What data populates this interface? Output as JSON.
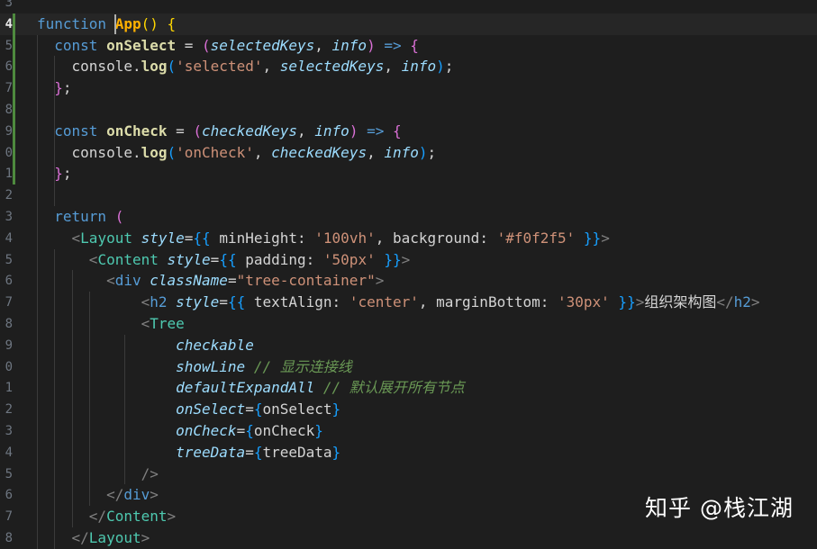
{
  "editor": {
    "gutter_numbers": [
      "3",
      "4",
      "5",
      "6",
      "7",
      "8",
      "9",
      "0",
      "1",
      "2",
      "3",
      "4",
      "5",
      "6",
      "7",
      "8",
      "9",
      "0",
      "1",
      "2",
      "3",
      "4",
      "5",
      "6",
      "7",
      "8"
    ],
    "current_line_index": 1,
    "lines": [
      {
        "tokens": []
      },
      {
        "tokens": [
          [
            "k",
            "function "
          ],
          [
            "fo",
            "App"
          ],
          [
            "p",
            "() {"
          ]
        ]
      },
      {
        "tokens": [
          [
            "k",
            "  const "
          ],
          [
            "f",
            "onSelect"
          ],
          [
            "",
            " = "
          ],
          [
            "pp",
            "("
          ],
          [
            "v",
            "selectedKeys"
          ],
          [
            "",
            ", "
          ],
          [
            "v",
            "info"
          ],
          [
            "pp",
            ")"
          ],
          [
            "k",
            " => "
          ],
          [
            "pp",
            "{"
          ]
        ]
      },
      {
        "tokens": [
          [
            "",
            "    console."
          ],
          [
            "f",
            "log"
          ],
          [
            "pb",
            "("
          ],
          [
            "s",
            "'selected'"
          ],
          [
            "",
            ", "
          ],
          [
            "v",
            "selectedKeys"
          ],
          [
            "",
            ", "
          ],
          [
            "v",
            "info"
          ],
          [
            "pb",
            ")"
          ],
          [
            "",
            ";"
          ]
        ]
      },
      {
        "tokens": [
          [
            "pp",
            "  }"
          ],
          [
            "",
            ";"
          ]
        ]
      },
      {
        "tokens": []
      },
      {
        "tokens": [
          [
            "k",
            "  const "
          ],
          [
            "f",
            "onCheck"
          ],
          [
            "",
            " = "
          ],
          [
            "pp",
            "("
          ],
          [
            "v",
            "checkedKeys"
          ],
          [
            "",
            ", "
          ],
          [
            "v",
            "info"
          ],
          [
            "pp",
            ")"
          ],
          [
            "k",
            " => "
          ],
          [
            "pp",
            "{"
          ]
        ]
      },
      {
        "tokens": [
          [
            "",
            "    console."
          ],
          [
            "f",
            "log"
          ],
          [
            "pb",
            "("
          ],
          [
            "s",
            "'onCheck'"
          ],
          [
            "",
            ", "
          ],
          [
            "v",
            "checkedKeys"
          ],
          [
            "",
            ", "
          ],
          [
            "v",
            "info"
          ],
          [
            "pb",
            ")"
          ],
          [
            "",
            ";"
          ]
        ]
      },
      {
        "tokens": [
          [
            "pp",
            "  }"
          ],
          [
            "",
            ";"
          ]
        ]
      },
      {
        "tokens": []
      },
      {
        "tokens": [
          [
            "k",
            "  return "
          ],
          [
            "pp",
            "("
          ]
        ]
      },
      {
        "tokens": [
          [
            "g",
            "    <"
          ],
          [
            "t",
            "Layout "
          ],
          [
            "a",
            "style"
          ],
          [
            "",
            "="
          ],
          [
            "pb",
            "{{"
          ],
          [
            "",
            " minHeight: "
          ],
          [
            "s",
            "'100vh'"
          ],
          [
            "",
            ", background: "
          ],
          [
            "s",
            "'#f0f2f5'"
          ],
          [
            "pb",
            " }}"
          ],
          [
            "g",
            ">"
          ]
        ]
      },
      {
        "tokens": [
          [
            "g",
            "      <"
          ],
          [
            "t",
            "Content "
          ],
          [
            "a",
            "style"
          ],
          [
            "",
            "="
          ],
          [
            "pb",
            "{{"
          ],
          [
            "",
            " padding: "
          ],
          [
            "s",
            "'50px'"
          ],
          [
            "pb",
            " }}"
          ],
          [
            "g",
            ">"
          ]
        ]
      },
      {
        "tokens": [
          [
            "g",
            "        <"
          ],
          [
            "k",
            "div "
          ],
          [
            "a",
            "className"
          ],
          [
            "",
            "="
          ],
          [
            "s",
            "\"tree-container\""
          ],
          [
            "g",
            ">"
          ]
        ]
      },
      {
        "tokens": [
          [
            "g",
            "            <"
          ],
          [
            "k",
            "h2 "
          ],
          [
            "a",
            "style"
          ],
          [
            "",
            "="
          ],
          [
            "pb",
            "{{"
          ],
          [
            "",
            " textAlign: "
          ],
          [
            "s",
            "'center'"
          ],
          [
            "",
            ", marginBottom: "
          ],
          [
            "s",
            "'30px'"
          ],
          [
            "pb",
            " }}"
          ],
          [
            "g",
            ">"
          ],
          [
            "",
            "组织架构图"
          ],
          [
            "g",
            "</"
          ],
          [
            "k",
            "h2"
          ],
          [
            "g",
            ">"
          ]
        ]
      },
      {
        "tokens": [
          [
            "g",
            "            <"
          ],
          [
            "t",
            "Tree"
          ]
        ]
      },
      {
        "tokens": [
          [
            "a",
            "                checkable"
          ]
        ]
      },
      {
        "tokens": [
          [
            "a",
            "                showLine"
          ],
          [
            "c",
            " // 显示连接线"
          ]
        ]
      },
      {
        "tokens": [
          [
            "a",
            "                defaultExpandAll"
          ],
          [
            "c",
            " // 默认展开所有节点"
          ]
        ]
      },
      {
        "tokens": [
          [
            "a",
            "                onSelect"
          ],
          [
            "",
            "="
          ],
          [
            "pb",
            "{"
          ],
          [
            "",
            "onSelect"
          ],
          [
            "pb",
            "}"
          ]
        ]
      },
      {
        "tokens": [
          [
            "a",
            "                onCheck"
          ],
          [
            "",
            "="
          ],
          [
            "pb",
            "{"
          ],
          [
            "",
            "onCheck"
          ],
          [
            "pb",
            "}"
          ]
        ]
      },
      {
        "tokens": [
          [
            "a",
            "                treeData"
          ],
          [
            "",
            "="
          ],
          [
            "pb",
            "{"
          ],
          [
            "",
            "treeData"
          ],
          [
            "pb",
            "}"
          ]
        ]
      },
      {
        "tokens": [
          [
            "g",
            "            />"
          ]
        ]
      },
      {
        "tokens": [
          [
            "g",
            "        </"
          ],
          [
            "k",
            "div"
          ],
          [
            "g",
            ">"
          ]
        ]
      },
      {
        "tokens": [
          [
            "g",
            "      </"
          ],
          [
            "t",
            "Content"
          ],
          [
            "g",
            ">"
          ]
        ]
      },
      {
        "tokens": [
          [
            "g",
            "    </"
          ],
          [
            "t",
            "Layout"
          ],
          [
            "g",
            ">"
          ]
        ]
      }
    ]
  },
  "watermark": "知乎 @栈江湖"
}
